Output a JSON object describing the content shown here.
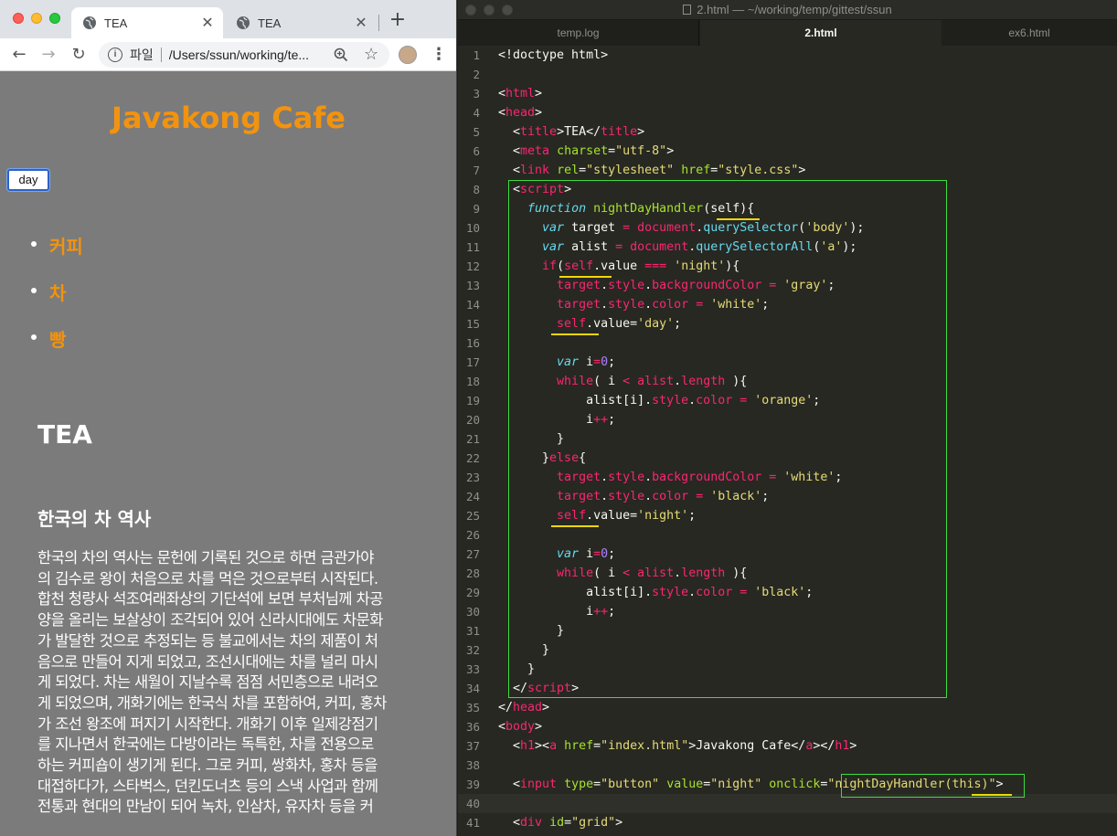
{
  "chrome": {
    "tabs": [
      {
        "label": "TEA",
        "close": "✕"
      },
      {
        "label": "TEA",
        "close": "✕"
      }
    ],
    "new_tab": "+",
    "scheme_label": "파일",
    "url": "/Users/ssun/working/te...",
    "page": {
      "title": "Javakong Cafe",
      "mode_button": "day",
      "nav": [
        "커피",
        "차",
        "빵"
      ],
      "heading": "TEA",
      "subheading": "한국의 차 역사",
      "body_lines": [
        "한국의 차의 역사는 문헌에 기록된 것으로 하면 금관가야",
        "의 김수로 왕이 처음으로 차를 먹은 것으로부터 시작된다.",
        "합천 청량사 석조여래좌상의 기단석에 보면 부처님께 차공",
        "양을 올리는 보살상이 조각되어 있어 신라시대에도 차문화",
        "가 발달한 것으로 추정되는 등 불교에서는 차의 제품이 처",
        "음으로 만들어 지게 되었고, 조선시대에는 차를 널리 마시",
        "게 되었다. 차는 새월이 지날수록 점점 서민층으로 내려오",
        "게 되었으며, 개화기에는 한국식 차를 포함하여, 커피, 홍차",
        "가 조선 왕조에 퍼지기 시작한다. 개화기 이후 일제강점기",
        "를 지나면서 한국에는 다방이라는 독특한, 차를 전용으로",
        "하는 커피숍이 생기게 된다. 그로 커피, 쌍화차, 홍차 등을",
        "대접하다가, 스타벅스, 던킨도너츠 등의 스낵 사업과 함께",
        "전통과 현대의 만남이 되어 녹차, 인삼차, 유자차 등을 커"
      ],
      "colors": {
        "background": "#7b7b7b",
        "link": "#f2930f",
        "text": "#ffffff"
      }
    }
  },
  "editor": {
    "window_title": "2.html — ~/working/temp/gittest/ssun",
    "tabs": [
      "temp.log",
      "2.html",
      "ex6.html"
    ],
    "active_tab": "2.html",
    "current_line": 40,
    "lines": [
      {
        "n": "1",
        "tokens": [
          [
            "pl",
            "<!doctype html>"
          ]
        ]
      },
      {
        "n": "2",
        "tokens": []
      },
      {
        "n": "3",
        "tokens": [
          [
            "pl",
            "<"
          ],
          [
            "tg",
            "html"
          ],
          [
            "pl",
            ">"
          ]
        ]
      },
      {
        "n": "4",
        "tokens": [
          [
            "pl",
            "<"
          ],
          [
            "tg",
            "head"
          ],
          [
            "pl",
            ">"
          ]
        ]
      },
      {
        "n": "5",
        "tokens": [
          [
            "pl",
            "  <"
          ],
          [
            "tg",
            "title"
          ],
          [
            "pl",
            ">TEA</"
          ],
          [
            "tg",
            "title"
          ],
          [
            "pl",
            ">"
          ]
        ]
      },
      {
        "n": "6",
        "tokens": [
          [
            "pl",
            "  <"
          ],
          [
            "tg",
            "meta"
          ],
          [
            "pl",
            " "
          ],
          [
            "at",
            "charset"
          ],
          [
            "pl",
            "="
          ],
          [
            "st",
            "\"utf-8\""
          ],
          [
            "pl",
            ">"
          ]
        ]
      },
      {
        "n": "7",
        "tokens": [
          [
            "pl",
            "  <"
          ],
          [
            "tg",
            "link"
          ],
          [
            "pl",
            " "
          ],
          [
            "at",
            "rel"
          ],
          [
            "pl",
            "="
          ],
          [
            "st",
            "\"stylesheet\""
          ],
          [
            "pl",
            " "
          ],
          [
            "at",
            "href"
          ],
          [
            "pl",
            "="
          ],
          [
            "st",
            "\"style.css\""
          ],
          [
            "pl",
            ">"
          ]
        ]
      },
      {
        "n": "8",
        "tokens": [
          [
            "pl",
            "  <"
          ],
          [
            "tg",
            "script"
          ],
          [
            "pl",
            ">"
          ]
        ]
      },
      {
        "n": "9",
        "tokens": [
          [
            "pl",
            "    "
          ],
          [
            "kw",
            "function"
          ],
          [
            "pl",
            " "
          ],
          [
            "fn",
            "nightDayHandler"
          ],
          [
            "pl",
            "(self){"
          ]
        ]
      },
      {
        "n": "10",
        "tokens": [
          [
            "pl",
            "      "
          ],
          [
            "kw",
            "var"
          ],
          [
            "pl",
            " target "
          ],
          [
            "mk",
            "="
          ],
          [
            "pl",
            " "
          ],
          [
            "mk",
            "document"
          ],
          [
            "pl",
            "."
          ],
          [
            "mt",
            "querySelector"
          ],
          [
            "pl",
            "("
          ],
          [
            "st",
            "'body'"
          ],
          [
            "pl",
            ");"
          ]
        ]
      },
      {
        "n": "11",
        "tokens": [
          [
            "pl",
            "      "
          ],
          [
            "kw",
            "var"
          ],
          [
            "pl",
            " alist "
          ],
          [
            "mk",
            "="
          ],
          [
            "pl",
            " "
          ],
          [
            "mk",
            "document"
          ],
          [
            "pl",
            "."
          ],
          [
            "mt",
            "querySelectorAll"
          ],
          [
            "pl",
            "("
          ],
          [
            "st",
            "'a'"
          ],
          [
            "pl",
            ");"
          ]
        ]
      },
      {
        "n": "12",
        "tokens": [
          [
            "pl",
            "      "
          ],
          [
            "mk",
            "if"
          ],
          [
            "pl",
            "("
          ],
          [
            "mk",
            "self"
          ],
          [
            "pl",
            ".value "
          ],
          [
            "mk",
            "==="
          ],
          [
            "pl",
            " "
          ],
          [
            "st",
            "'night'"
          ],
          [
            "pl",
            "){"
          ]
        ]
      },
      {
        "n": "13",
        "tokens": [
          [
            "pl",
            "        "
          ],
          [
            "mk",
            "target"
          ],
          [
            "pl",
            "."
          ],
          [
            "mk",
            "style"
          ],
          [
            "pl",
            "."
          ],
          [
            "mk",
            "backgroundColor"
          ],
          [
            "pl",
            " "
          ],
          [
            "mk",
            "="
          ],
          [
            "pl",
            " "
          ],
          [
            "st",
            "'gray'"
          ],
          [
            "pl",
            ";"
          ]
        ]
      },
      {
        "n": "14",
        "tokens": [
          [
            "pl",
            "        "
          ],
          [
            "mk",
            "target"
          ],
          [
            "pl",
            "."
          ],
          [
            "mk",
            "style"
          ],
          [
            "pl",
            "."
          ],
          [
            "mk",
            "color"
          ],
          [
            "pl",
            " "
          ],
          [
            "mk",
            "="
          ],
          [
            "pl",
            " "
          ],
          [
            "st",
            "'white'"
          ],
          [
            "pl",
            ";"
          ]
        ]
      },
      {
        "n": "15",
        "tokens": [
          [
            "pl",
            "        "
          ],
          [
            "mk",
            "self"
          ],
          [
            "pl",
            ".value="
          ],
          [
            "st",
            "'day'"
          ],
          [
            "pl",
            ";"
          ]
        ]
      },
      {
        "n": "16",
        "tokens": []
      },
      {
        "n": "17",
        "tokens": [
          [
            "pl",
            "        "
          ],
          [
            "kw",
            "var"
          ],
          [
            "pl",
            " i"
          ],
          [
            "mk",
            "="
          ],
          [
            "nm",
            "0"
          ],
          [
            "pl",
            ";"
          ]
        ]
      },
      {
        "n": "18",
        "tokens": [
          [
            "pl",
            "        "
          ],
          [
            "mk",
            "while"
          ],
          [
            "pl",
            "( i "
          ],
          [
            "mk",
            "<"
          ],
          [
            "pl",
            " "
          ],
          [
            "mk",
            "alist"
          ],
          [
            "pl",
            "."
          ],
          [
            "mk",
            "length"
          ],
          [
            "pl",
            " ){"
          ]
        ]
      },
      {
        "n": "19",
        "tokens": [
          [
            "pl",
            "            alist[i]."
          ],
          [
            "mk",
            "style"
          ],
          [
            "pl",
            "."
          ],
          [
            "mk",
            "color"
          ],
          [
            "pl",
            " "
          ],
          [
            "mk",
            "="
          ],
          [
            "pl",
            " "
          ],
          [
            "st",
            "'orange'"
          ],
          [
            "pl",
            ";"
          ]
        ]
      },
      {
        "n": "20",
        "tokens": [
          [
            "pl",
            "            i"
          ],
          [
            "mk",
            "++"
          ],
          [
            "pl",
            ";"
          ]
        ]
      },
      {
        "n": "21",
        "tokens": [
          [
            "pl",
            "        }"
          ]
        ]
      },
      {
        "n": "22",
        "tokens": [
          [
            "pl",
            "      }"
          ],
          [
            "mk",
            "else"
          ],
          [
            "pl",
            "{"
          ]
        ]
      },
      {
        "n": "23",
        "tokens": [
          [
            "pl",
            "        "
          ],
          [
            "mk",
            "target"
          ],
          [
            "pl",
            "."
          ],
          [
            "mk",
            "style"
          ],
          [
            "pl",
            "."
          ],
          [
            "mk",
            "backgroundColor"
          ],
          [
            "pl",
            " "
          ],
          [
            "mk",
            "="
          ],
          [
            "pl",
            " "
          ],
          [
            "st",
            "'white'"
          ],
          [
            "pl",
            ";"
          ]
        ]
      },
      {
        "n": "24",
        "tokens": [
          [
            "pl",
            "        "
          ],
          [
            "mk",
            "target"
          ],
          [
            "pl",
            "."
          ],
          [
            "mk",
            "style"
          ],
          [
            "pl",
            "."
          ],
          [
            "mk",
            "color"
          ],
          [
            "pl",
            " "
          ],
          [
            "mk",
            "="
          ],
          [
            "pl",
            " "
          ],
          [
            "st",
            "'black'"
          ],
          [
            "pl",
            ";"
          ]
        ]
      },
      {
        "n": "25",
        "tokens": [
          [
            "pl",
            "        "
          ],
          [
            "mk",
            "self"
          ],
          [
            "pl",
            ".value="
          ],
          [
            "st",
            "'night'"
          ],
          [
            "pl",
            ";"
          ]
        ]
      },
      {
        "n": "26",
        "tokens": []
      },
      {
        "n": "27",
        "tokens": [
          [
            "pl",
            "        "
          ],
          [
            "kw",
            "var"
          ],
          [
            "pl",
            " i"
          ],
          [
            "mk",
            "="
          ],
          [
            "nm",
            "0"
          ],
          [
            "pl",
            ";"
          ]
        ]
      },
      {
        "n": "28",
        "tokens": [
          [
            "pl",
            "        "
          ],
          [
            "mk",
            "while"
          ],
          [
            "pl",
            "( i "
          ],
          [
            "mk",
            "<"
          ],
          [
            "pl",
            " "
          ],
          [
            "mk",
            "alist"
          ],
          [
            "pl",
            "."
          ],
          [
            "mk",
            "length"
          ],
          [
            "pl",
            " ){"
          ]
        ]
      },
      {
        "n": "29",
        "tokens": [
          [
            "pl",
            "            alist[i]."
          ],
          [
            "mk",
            "style"
          ],
          [
            "pl",
            "."
          ],
          [
            "mk",
            "color"
          ],
          [
            "pl",
            " "
          ],
          [
            "mk",
            "="
          ],
          [
            "pl",
            " "
          ],
          [
            "st",
            "'black'"
          ],
          [
            "pl",
            ";"
          ]
        ]
      },
      {
        "n": "30",
        "tokens": [
          [
            "pl",
            "            i"
          ],
          [
            "mk",
            "++"
          ],
          [
            "pl",
            ";"
          ]
        ]
      },
      {
        "n": "31",
        "tokens": [
          [
            "pl",
            "        }"
          ]
        ]
      },
      {
        "n": "32",
        "tokens": [
          [
            "pl",
            "      }"
          ]
        ]
      },
      {
        "n": "33",
        "tokens": [
          [
            "pl",
            "    }"
          ]
        ]
      },
      {
        "n": "34",
        "tokens": [
          [
            "pl",
            "  </"
          ],
          [
            "tg",
            "script"
          ],
          [
            "pl",
            ">"
          ]
        ]
      },
      {
        "n": "35",
        "tokens": [
          [
            "pl",
            "</"
          ],
          [
            "tg",
            "head"
          ],
          [
            "pl",
            ">"
          ]
        ]
      },
      {
        "n": "36",
        "tokens": [
          [
            "pl",
            "<"
          ],
          [
            "tg",
            "body"
          ],
          [
            "pl",
            ">"
          ]
        ]
      },
      {
        "n": "37",
        "tokens": [
          [
            "pl",
            "  <"
          ],
          [
            "tg",
            "h1"
          ],
          [
            "pl",
            "><"
          ],
          [
            "tg",
            "a"
          ],
          [
            "pl",
            " "
          ],
          [
            "at",
            "href"
          ],
          [
            "pl",
            "="
          ],
          [
            "st",
            "\"index.html\""
          ],
          [
            "pl",
            ">Javakong Cafe</"
          ],
          [
            "tg",
            "a"
          ],
          [
            "pl",
            "></"
          ],
          [
            "tg",
            "h1"
          ],
          [
            "pl",
            ">"
          ]
        ]
      },
      {
        "n": "38",
        "tokens": []
      },
      {
        "n": "39",
        "tokens": [
          [
            "pl",
            "  <"
          ],
          [
            "tg",
            "input"
          ],
          [
            "pl",
            " "
          ],
          [
            "at",
            "type"
          ],
          [
            "pl",
            "="
          ],
          [
            "st",
            "\"button\""
          ],
          [
            "pl",
            " "
          ],
          [
            "at",
            "value"
          ],
          [
            "pl",
            "="
          ],
          [
            "st",
            "\"night\""
          ],
          [
            "pl",
            " "
          ],
          [
            "at",
            "onclick"
          ],
          [
            "pl",
            "="
          ],
          [
            "st",
            "\"nightDayHandler(this)\""
          ],
          [
            "pl",
            ">"
          ]
        ]
      },
      {
        "n": "40",
        "tokens": []
      },
      {
        "n": "41",
        "tokens": [
          [
            "pl",
            "  <"
          ],
          [
            "tg",
            "div"
          ],
          [
            "pl",
            " "
          ],
          [
            "at",
            "id"
          ],
          [
            "pl",
            "="
          ],
          [
            "st",
            "\"grid\""
          ],
          [
            "pl",
            ">"
          ]
        ]
      }
    ],
    "colors": {
      "background": "#272822",
      "highlight_box": "#3ddc3d",
      "underline": "#f3d60c"
    }
  }
}
